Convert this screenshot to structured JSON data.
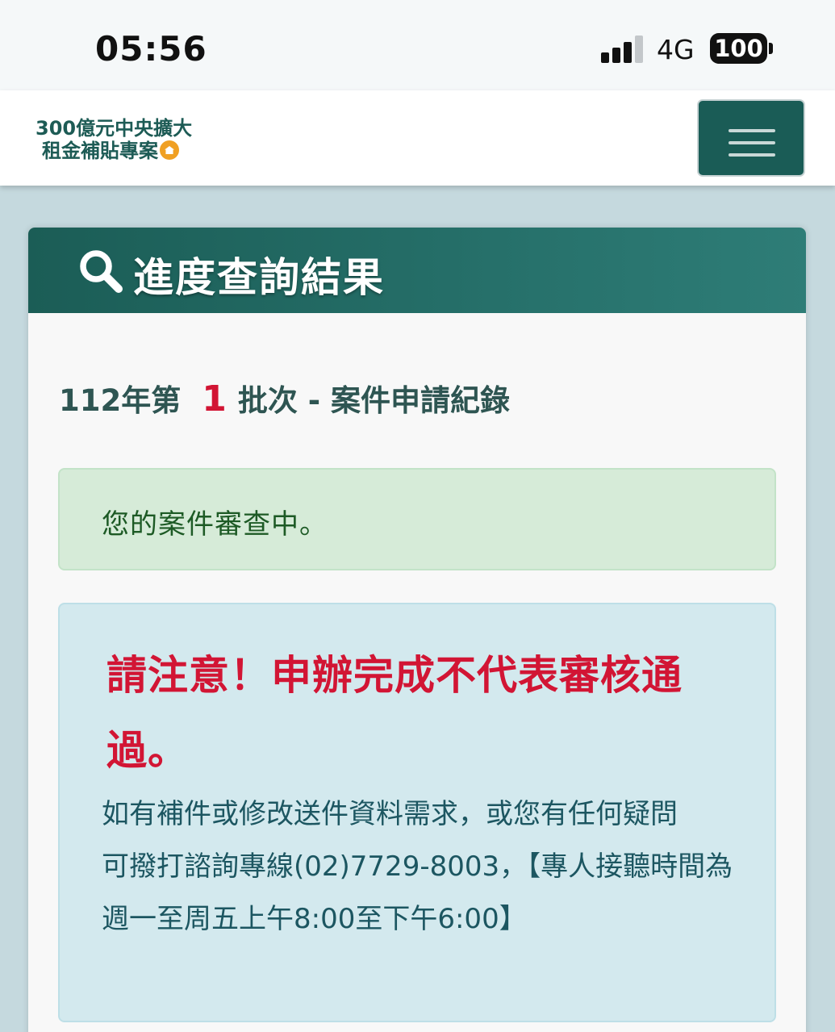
{
  "status_bar": {
    "time": "05:56",
    "network": "4G",
    "battery": "100"
  },
  "navbar": {
    "brand_line1": "300億元中央擴大",
    "brand_line2": "租金補貼專案",
    "menu_icon": "hamburger-menu-icon"
  },
  "card": {
    "icon": "search-icon",
    "title": "進度查詢結果",
    "batch_prefix": "112年第",
    "batch_number": "1",
    "batch_suffix": "批次 - 案件申請紀錄",
    "status_message": "您的案件審查中。",
    "notice": {
      "warning": "請注意！申辦完成不代表審核通過。",
      "line1": "如有補件或修改送件資料需求，或您有任何疑問",
      "line2": "可撥打諮詢專線(02)7729-8003，【專人接聽時間為週一至周五上午8:00至下午6:00】"
    }
  },
  "colors": {
    "header_bg": "#1b5d56",
    "accent_red": "#d21534",
    "success_bg": "#d6ebd8",
    "info_bg": "#d3e9ee"
  }
}
